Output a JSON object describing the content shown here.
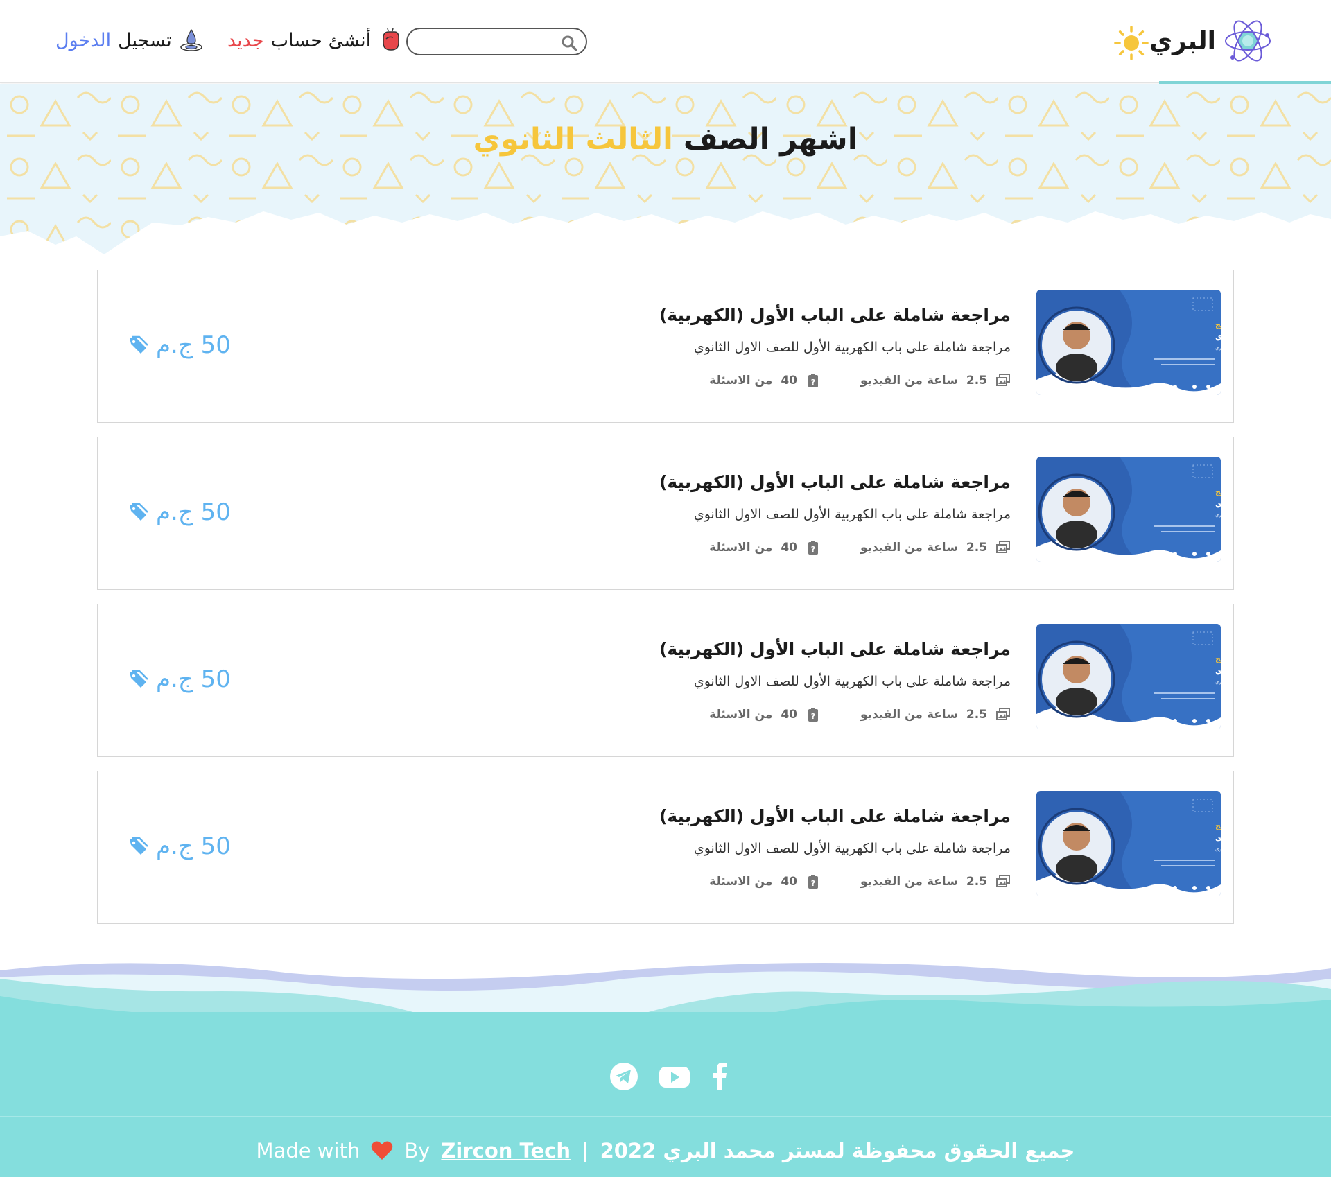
{
  "header": {
    "logo_text": "البري",
    "search": {
      "placeholder": "",
      "value": ""
    },
    "register": {
      "main": "أنشئ حساب",
      "accent": "جديد"
    },
    "login": {
      "main": "تسجيل",
      "accent": "الدخول"
    }
  },
  "hero": {
    "title_main": "اشهر الصف",
    "title_accent": "الثالث الثانوي"
  },
  "courses": [
    {
      "title": "مراجعة شاملة على الباب الأول (الكهربية)",
      "description": "مراجعة شاملة على باب الكهربية الأول للصف الاول الثانوي",
      "video_hours": "2.5",
      "video_label": "ساعة من الفيديو",
      "questions_count": "40",
      "questions_label": "من الاسئلة",
      "price": "50 ج.م"
    },
    {
      "title": "مراجعة شاملة على الباب الأول (الكهربية)",
      "description": "مراجعة شاملة على باب الكهربية الأول للصف الاول الثانوي",
      "video_hours": "2.5",
      "video_label": "ساعة من الفيديو",
      "questions_count": "40",
      "questions_label": "من الاسئلة",
      "price": "50 ج.م"
    },
    {
      "title": "مراجعة شاملة على الباب الأول (الكهربية)",
      "description": "مراجعة شاملة على باب الكهربية الأول للصف الاول الثانوي",
      "video_hours": "2.5",
      "video_label": "ساعة من الفيديو",
      "questions_count": "40",
      "questions_label": "من الاسئلة",
      "price": "50 ج.م"
    },
    {
      "title": "مراجعة شاملة على الباب الأول (الكهربية)",
      "description": "مراجعة شاملة على باب الكهربية الأول للصف الاول الثانوي",
      "video_hours": "2.5",
      "video_label": "ساعة من الفيديو",
      "questions_count": "40",
      "questions_label": "من الاسئلة",
      "price": "50 ج.م"
    }
  ],
  "thumbnail": {
    "headline": "مراجعة شاملة على المنهج",
    "subline": "للصف الثاني الثانوي",
    "teacher": "أ. محمد البري"
  },
  "footer": {
    "social": [
      "telegram-icon",
      "youtube-icon",
      "facebook-icon"
    ],
    "copyright": "جميع الحقوق محفوظة لمستر محمد البري 2022",
    "separator": "|",
    "made_with": "Made with",
    "by": "By",
    "company": "Zircon Tech"
  },
  "colors": {
    "accent_yellow": "#f6c63c",
    "register_red": "#e8474b",
    "login_blue": "#5b7ef0",
    "price_blue": "#5fb3f0",
    "footer_teal": "#84dedd",
    "thumb_blue": "#2f62b3"
  }
}
